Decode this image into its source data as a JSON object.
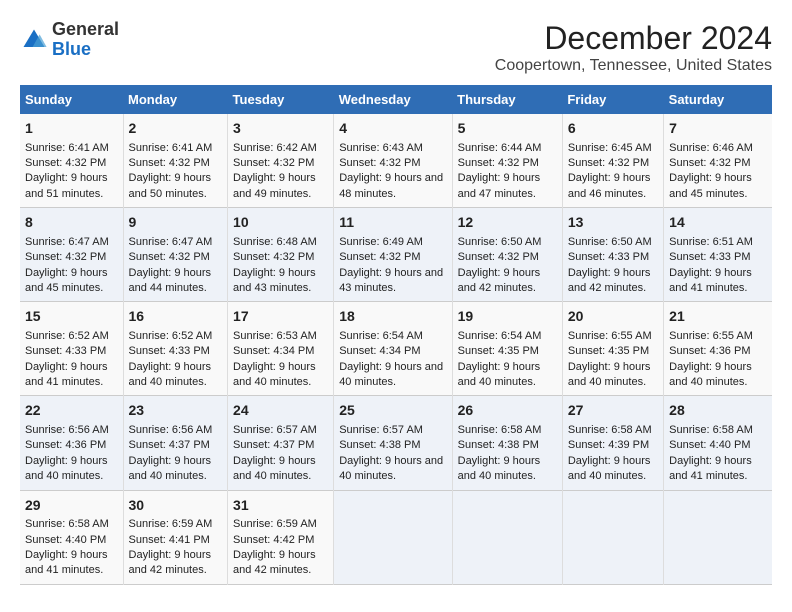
{
  "logo": {
    "text_general": "General",
    "text_blue": "Blue"
  },
  "title": "December 2024",
  "subtitle": "Coopertown, Tennessee, United States",
  "headers": [
    "Sunday",
    "Monday",
    "Tuesday",
    "Wednesday",
    "Thursday",
    "Friday",
    "Saturday"
  ],
  "weeks": [
    [
      {
        "day": "1",
        "sunrise": "Sunrise: 6:41 AM",
        "sunset": "Sunset: 4:32 PM",
        "daylight": "Daylight: 9 hours and 51 minutes."
      },
      {
        "day": "2",
        "sunrise": "Sunrise: 6:41 AM",
        "sunset": "Sunset: 4:32 PM",
        "daylight": "Daylight: 9 hours and 50 minutes."
      },
      {
        "day": "3",
        "sunrise": "Sunrise: 6:42 AM",
        "sunset": "Sunset: 4:32 PM",
        "daylight": "Daylight: 9 hours and 49 minutes."
      },
      {
        "day": "4",
        "sunrise": "Sunrise: 6:43 AM",
        "sunset": "Sunset: 4:32 PM",
        "daylight": "Daylight: 9 hours and 48 minutes."
      },
      {
        "day": "5",
        "sunrise": "Sunrise: 6:44 AM",
        "sunset": "Sunset: 4:32 PM",
        "daylight": "Daylight: 9 hours and 47 minutes."
      },
      {
        "day": "6",
        "sunrise": "Sunrise: 6:45 AM",
        "sunset": "Sunset: 4:32 PM",
        "daylight": "Daylight: 9 hours and 46 minutes."
      },
      {
        "day": "7",
        "sunrise": "Sunrise: 6:46 AM",
        "sunset": "Sunset: 4:32 PM",
        "daylight": "Daylight: 9 hours and 45 minutes."
      }
    ],
    [
      {
        "day": "8",
        "sunrise": "Sunrise: 6:47 AM",
        "sunset": "Sunset: 4:32 PM",
        "daylight": "Daylight: 9 hours and 45 minutes."
      },
      {
        "day": "9",
        "sunrise": "Sunrise: 6:47 AM",
        "sunset": "Sunset: 4:32 PM",
        "daylight": "Daylight: 9 hours and 44 minutes."
      },
      {
        "day": "10",
        "sunrise": "Sunrise: 6:48 AM",
        "sunset": "Sunset: 4:32 PM",
        "daylight": "Daylight: 9 hours and 43 minutes."
      },
      {
        "day": "11",
        "sunrise": "Sunrise: 6:49 AM",
        "sunset": "Sunset: 4:32 PM",
        "daylight": "Daylight: 9 hours and 43 minutes."
      },
      {
        "day": "12",
        "sunrise": "Sunrise: 6:50 AM",
        "sunset": "Sunset: 4:32 PM",
        "daylight": "Daylight: 9 hours and 42 minutes."
      },
      {
        "day": "13",
        "sunrise": "Sunrise: 6:50 AM",
        "sunset": "Sunset: 4:33 PM",
        "daylight": "Daylight: 9 hours and 42 minutes."
      },
      {
        "day": "14",
        "sunrise": "Sunrise: 6:51 AM",
        "sunset": "Sunset: 4:33 PM",
        "daylight": "Daylight: 9 hours and 41 minutes."
      }
    ],
    [
      {
        "day": "15",
        "sunrise": "Sunrise: 6:52 AM",
        "sunset": "Sunset: 4:33 PM",
        "daylight": "Daylight: 9 hours and 41 minutes."
      },
      {
        "day": "16",
        "sunrise": "Sunrise: 6:52 AM",
        "sunset": "Sunset: 4:33 PM",
        "daylight": "Daylight: 9 hours and 40 minutes."
      },
      {
        "day": "17",
        "sunrise": "Sunrise: 6:53 AM",
        "sunset": "Sunset: 4:34 PM",
        "daylight": "Daylight: 9 hours and 40 minutes."
      },
      {
        "day": "18",
        "sunrise": "Sunrise: 6:54 AM",
        "sunset": "Sunset: 4:34 PM",
        "daylight": "Daylight: 9 hours and 40 minutes."
      },
      {
        "day": "19",
        "sunrise": "Sunrise: 6:54 AM",
        "sunset": "Sunset: 4:35 PM",
        "daylight": "Daylight: 9 hours and 40 minutes."
      },
      {
        "day": "20",
        "sunrise": "Sunrise: 6:55 AM",
        "sunset": "Sunset: 4:35 PM",
        "daylight": "Daylight: 9 hours and 40 minutes."
      },
      {
        "day": "21",
        "sunrise": "Sunrise: 6:55 AM",
        "sunset": "Sunset: 4:36 PM",
        "daylight": "Daylight: 9 hours and 40 minutes."
      }
    ],
    [
      {
        "day": "22",
        "sunrise": "Sunrise: 6:56 AM",
        "sunset": "Sunset: 4:36 PM",
        "daylight": "Daylight: 9 hours and 40 minutes."
      },
      {
        "day": "23",
        "sunrise": "Sunrise: 6:56 AM",
        "sunset": "Sunset: 4:37 PM",
        "daylight": "Daylight: 9 hours and 40 minutes."
      },
      {
        "day": "24",
        "sunrise": "Sunrise: 6:57 AM",
        "sunset": "Sunset: 4:37 PM",
        "daylight": "Daylight: 9 hours and 40 minutes."
      },
      {
        "day": "25",
        "sunrise": "Sunrise: 6:57 AM",
        "sunset": "Sunset: 4:38 PM",
        "daylight": "Daylight: 9 hours and 40 minutes."
      },
      {
        "day": "26",
        "sunrise": "Sunrise: 6:58 AM",
        "sunset": "Sunset: 4:38 PM",
        "daylight": "Daylight: 9 hours and 40 minutes."
      },
      {
        "day": "27",
        "sunrise": "Sunrise: 6:58 AM",
        "sunset": "Sunset: 4:39 PM",
        "daylight": "Daylight: 9 hours and 40 minutes."
      },
      {
        "day": "28",
        "sunrise": "Sunrise: 6:58 AM",
        "sunset": "Sunset: 4:40 PM",
        "daylight": "Daylight: 9 hours and 41 minutes."
      }
    ],
    [
      {
        "day": "29",
        "sunrise": "Sunrise: 6:58 AM",
        "sunset": "Sunset: 4:40 PM",
        "daylight": "Daylight: 9 hours and 41 minutes."
      },
      {
        "day": "30",
        "sunrise": "Sunrise: 6:59 AM",
        "sunset": "Sunset: 4:41 PM",
        "daylight": "Daylight: 9 hours and 42 minutes."
      },
      {
        "day": "31",
        "sunrise": "Sunrise: 6:59 AM",
        "sunset": "Sunset: 4:42 PM",
        "daylight": "Daylight: 9 hours and 42 minutes."
      },
      null,
      null,
      null,
      null
    ]
  ]
}
